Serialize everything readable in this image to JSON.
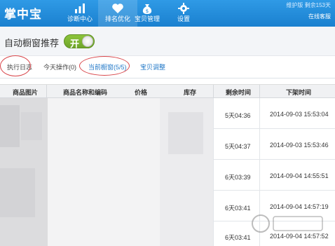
{
  "app": {
    "logo": "掌中宝"
  },
  "nav": [
    {
      "label": "诊断中心",
      "icon": "chart-icon"
    },
    {
      "label": "排名优化",
      "icon": "heart-icon"
    },
    {
      "label": "宝贝管理",
      "icon": "money-bag-icon"
    },
    {
      "label": "设置",
      "icon": "gear-icon"
    }
  ],
  "status": {
    "line1": "维护版  剩余153天",
    "online": "在线客服"
  },
  "auto": {
    "label": "自动橱窗推荐",
    "toggle_text": "开"
  },
  "tabs": [
    {
      "label": "执行日志"
    },
    {
      "label": "今天操作(0)"
    },
    {
      "label": "当前橱窗(5/5)"
    },
    {
      "label": "宝贝调整"
    }
  ],
  "table": {
    "headers": [
      "商品图片",
      "商品名称和编码",
      "价格",
      "库存",
      "剩余时间",
      "下架时间"
    ],
    "rows": [
      {
        "remaining": "5天04:36",
        "offshelf": "2014-09-03 15:53:04"
      },
      {
        "remaining": "5天04:37",
        "offshelf": "2014-09-03 15:53:46"
      },
      {
        "remaining": "6天03:39",
        "offshelf": "2014-09-04 14:55:51"
      },
      {
        "remaining": "6天03:41",
        "offshelf": "2014-09-04 14:57:19"
      },
      {
        "remaining": "6天03:41",
        "offshelf": "2014-09-04 14:57:52"
      }
    ]
  },
  "colors": {
    "topbar": "#1f8ad9",
    "accent_blue": "#2379c8",
    "toggle_green": "#7db332",
    "annotation_red": "#d8454a"
  }
}
